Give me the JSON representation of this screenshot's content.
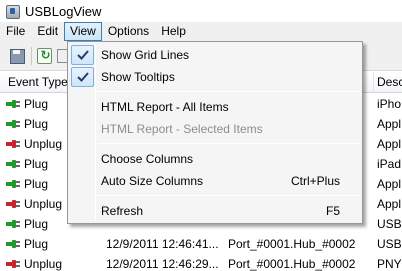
{
  "window": {
    "title": "USBLogView"
  },
  "menubar": {
    "items": [
      "File",
      "Edit",
      "View",
      "Options",
      "Help"
    ],
    "active": "View"
  },
  "toolbar": {
    "buttons": [
      "save-icon",
      "refresh-icon",
      "copy-icon"
    ]
  },
  "table": {
    "columns": [
      "Event Type",
      "",
      "",
      "Desc"
    ],
    "rows": [
      {
        "event": "Plug",
        "date": "",
        "port": "",
        "desc": "iPho",
        "icon": "plug-green-icon"
      },
      {
        "event": "Plug",
        "date": "",
        "port": "",
        "desc": "Appl",
        "icon": "plug-green-icon"
      },
      {
        "event": "Unplug",
        "date": "",
        "port": "",
        "desc": "Appl",
        "icon": "plug-red-icon"
      },
      {
        "event": "Plug",
        "date": "",
        "port": "",
        "desc": "iPad",
        "icon": "plug-green-icon"
      },
      {
        "event": "Plug",
        "date": "",
        "port": "",
        "desc": "Appl",
        "icon": "plug-green-icon"
      },
      {
        "event": "Unplug",
        "date": "",
        "port": "",
        "desc": "Appl",
        "icon": "plug-red-icon"
      },
      {
        "event": "Plug",
        "date": "",
        "port": "",
        "desc": "USB",
        "icon": "plug-green-icon"
      },
      {
        "event": "Plug",
        "date": "12/9/2011 12:46:41...",
        "port": "Port_#0001.Hub_#0002",
        "desc": "USB",
        "icon": "plug-green-icon"
      },
      {
        "event": "Unplug",
        "date": "12/9/2011 12:46:29...",
        "port": "Port_#0001.Hub_#0002",
        "desc": "PNY",
        "icon": "plug-red-icon"
      }
    ]
  },
  "view_menu": {
    "items": [
      {
        "label": "Show Grid Lines",
        "checked": true,
        "disabled": false,
        "shortcut": ""
      },
      {
        "label": "Show Tooltips",
        "checked": true,
        "disabled": false,
        "shortcut": ""
      },
      {
        "label": "HTML Report - All Items",
        "checked": false,
        "disabled": false,
        "shortcut": ""
      },
      {
        "label": "HTML Report - Selected Items",
        "checked": false,
        "disabled": true,
        "shortcut": ""
      },
      {
        "label": "Choose Columns",
        "checked": false,
        "disabled": false,
        "shortcut": ""
      },
      {
        "label": "Auto Size Columns",
        "checked": false,
        "disabled": false,
        "shortcut": "Ctrl+Plus"
      },
      {
        "label": "Refresh",
        "checked": false,
        "disabled": false,
        "shortcut": "F5"
      }
    ]
  },
  "colors": {
    "plug": "#1f9a2a",
    "unplug": "#c9232b",
    "menu_highlight": "#cde6f7"
  }
}
